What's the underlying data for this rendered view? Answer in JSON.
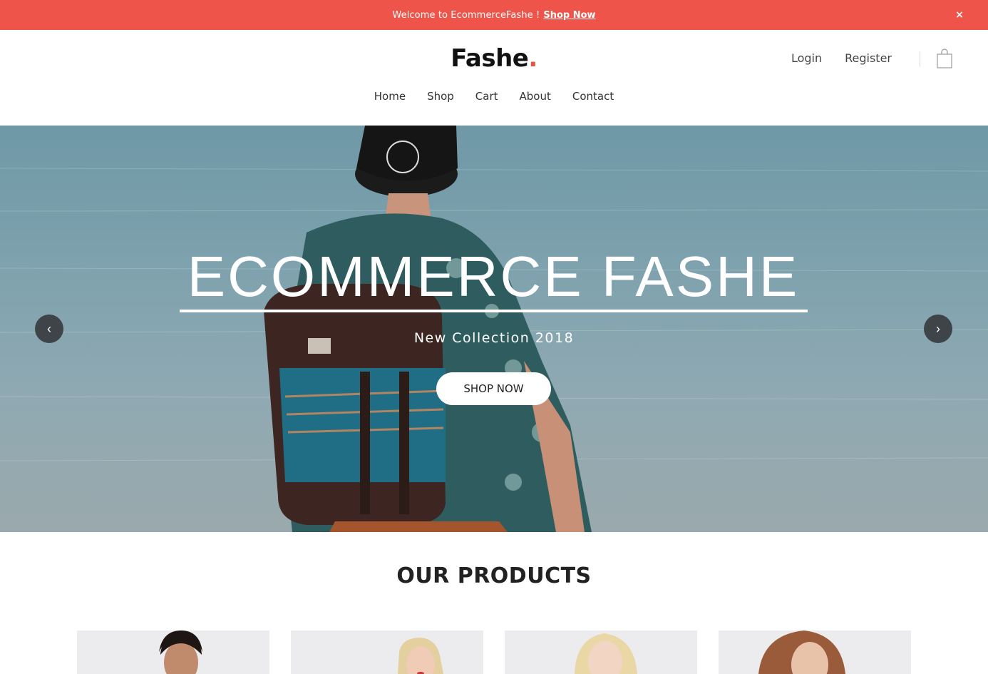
{
  "topbar": {
    "message": "Welcome to EcommerceFashe !",
    "link": "Shop Now",
    "close": "×"
  },
  "header": {
    "logo_text": "Fashe",
    "logo_dot": ".",
    "account": {
      "login": "Login",
      "register": "Register"
    },
    "nav": [
      "Home",
      "Shop",
      "Cart",
      "About",
      "Contact"
    ]
  },
  "hero": {
    "title": "ECOMMERCE FASHE",
    "subtitle": "New Collection 2018",
    "button": "SHOP NOW",
    "prev": "‹",
    "next": "›"
  },
  "products": {
    "title": "OUR PRODUCTS"
  },
  "colors": {
    "accent": "#ee5449",
    "logo_dot": "#e65540",
    "arrow_bg": "#3e4448"
  }
}
